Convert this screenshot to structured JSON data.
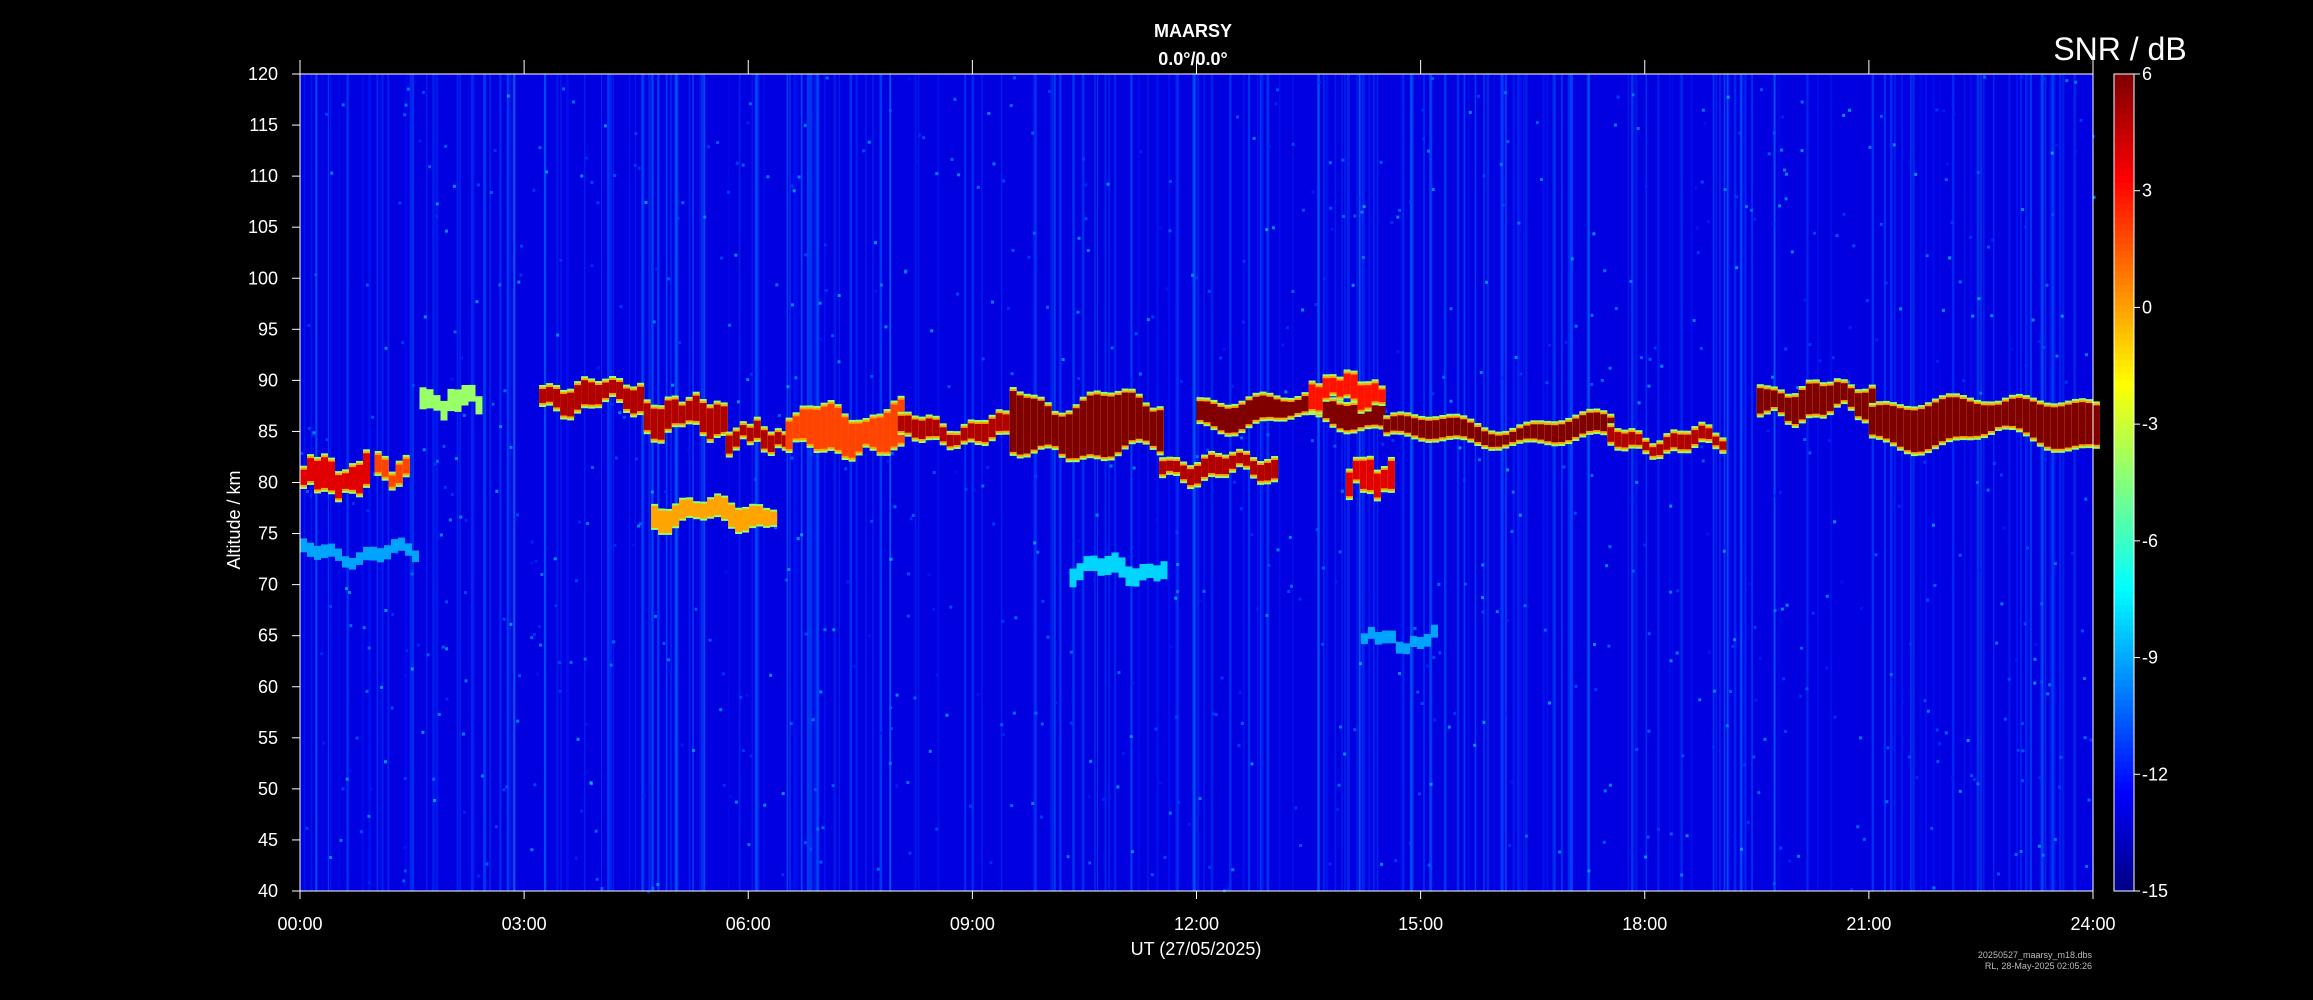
{
  "chart_data": {
    "type": "heatmap",
    "title": "MAARSY",
    "subtitle": "0.0°/0.0°",
    "xlabel": "UT (27/05/2025)",
    "ylabel": "Altitude / km",
    "xlim": [
      0,
      24
    ],
    "ylim": [
      40,
      120
    ],
    "x_ticks": [
      "00:00",
      "03:00",
      "06:00",
      "09:00",
      "12:00",
      "15:00",
      "18:00",
      "21:00",
      "24:00"
    ],
    "y_ticks": [
      40,
      45,
      50,
      55,
      60,
      65,
      70,
      75,
      80,
      85,
      90,
      95,
      100,
      105,
      110,
      115,
      120
    ],
    "colorbar": {
      "label": "SNR / dB",
      "range": [
        -15,
        6
      ],
      "ticks": [
        6,
        3,
        0,
        -3,
        -6,
        -9,
        -12,
        -15
      ],
      "colormap": "jet"
    },
    "background_snr_db": -13,
    "echo_layers": [
      {
        "t0": 0.0,
        "t1": 0.9,
        "alt": 80.5,
        "thick": 2.5,
        "snr": 4
      },
      {
        "t0": 1.0,
        "t1": 1.4,
        "alt": 81.0,
        "thick": 1.5,
        "snr": 2
      },
      {
        "t0": 1.6,
        "t1": 2.4,
        "alt": 88.0,
        "thick": 1.2,
        "snr": -4
      },
      {
        "t0": 3.2,
        "t1": 4.6,
        "alt": 88.5,
        "thick": 2.0,
        "snr": 5
      },
      {
        "t0": 4.6,
        "t1": 5.7,
        "alt": 86.5,
        "thick": 2.5,
        "snr": 5
      },
      {
        "t0": 5.7,
        "t1": 6.5,
        "alt": 84.5,
        "thick": 1.5,
        "snr": 5
      },
      {
        "t0": 6.5,
        "t1": 8.0,
        "alt": 85.0,
        "thick": 3.5,
        "snr": 2
      },
      {
        "t0": 8.0,
        "t1": 9.5,
        "alt": 85.0,
        "thick": 1.5,
        "snr": 5
      },
      {
        "t0": 9.5,
        "t1": 11.5,
        "alt": 85.5,
        "thick": 5.0,
        "snr": 6
      },
      {
        "t0": 11.5,
        "t1": 13.0,
        "alt": 81.5,
        "thick": 1.5,
        "snr": 5
      },
      {
        "t0": 12.0,
        "t1": 14.5,
        "alt": 87.0,
        "thick": 2.0,
        "snr": 6
      },
      {
        "t0": 13.5,
        "t1": 14.5,
        "alt": 89.0,
        "thick": 2.0,
        "snr": 3
      },
      {
        "t0": 14.0,
        "t1": 14.6,
        "alt": 80.5,
        "thick": 2.5,
        "snr": 4
      },
      {
        "t0": 14.5,
        "t1": 17.5,
        "alt": 85.0,
        "thick": 1.5,
        "snr": 6
      },
      {
        "t0": 17.5,
        "t1": 19.0,
        "alt": 84.0,
        "thick": 1.2,
        "snr": 5
      },
      {
        "t0": 19.5,
        "t1": 21.0,
        "alt": 88.0,
        "thick": 2.5,
        "snr": 6
      },
      {
        "t0": 21.0,
        "t1": 24.0,
        "alt": 86.0,
        "thick": 3.5,
        "snr": 6
      },
      {
        "t0": 4.7,
        "t1": 6.3,
        "alt": 77.0,
        "thick": 1.5,
        "snr": 0
      },
      {
        "t0": 10.3,
        "t1": 11.6,
        "alt": 71.5,
        "thick": 1.0,
        "snr": -8
      },
      {
        "t0": 14.2,
        "t1": 15.2,
        "alt": 64.5,
        "thick": 0.4,
        "snr": -9
      },
      {
        "t0": 0.0,
        "t1": 1.5,
        "alt": 73.0,
        "thick": 0.5,
        "snr": -9
      }
    ]
  },
  "footer": {
    "line1": "20250527_maarsy_m18.dbs",
    "line2": "RL, 28-May-2025 02:05:26"
  }
}
